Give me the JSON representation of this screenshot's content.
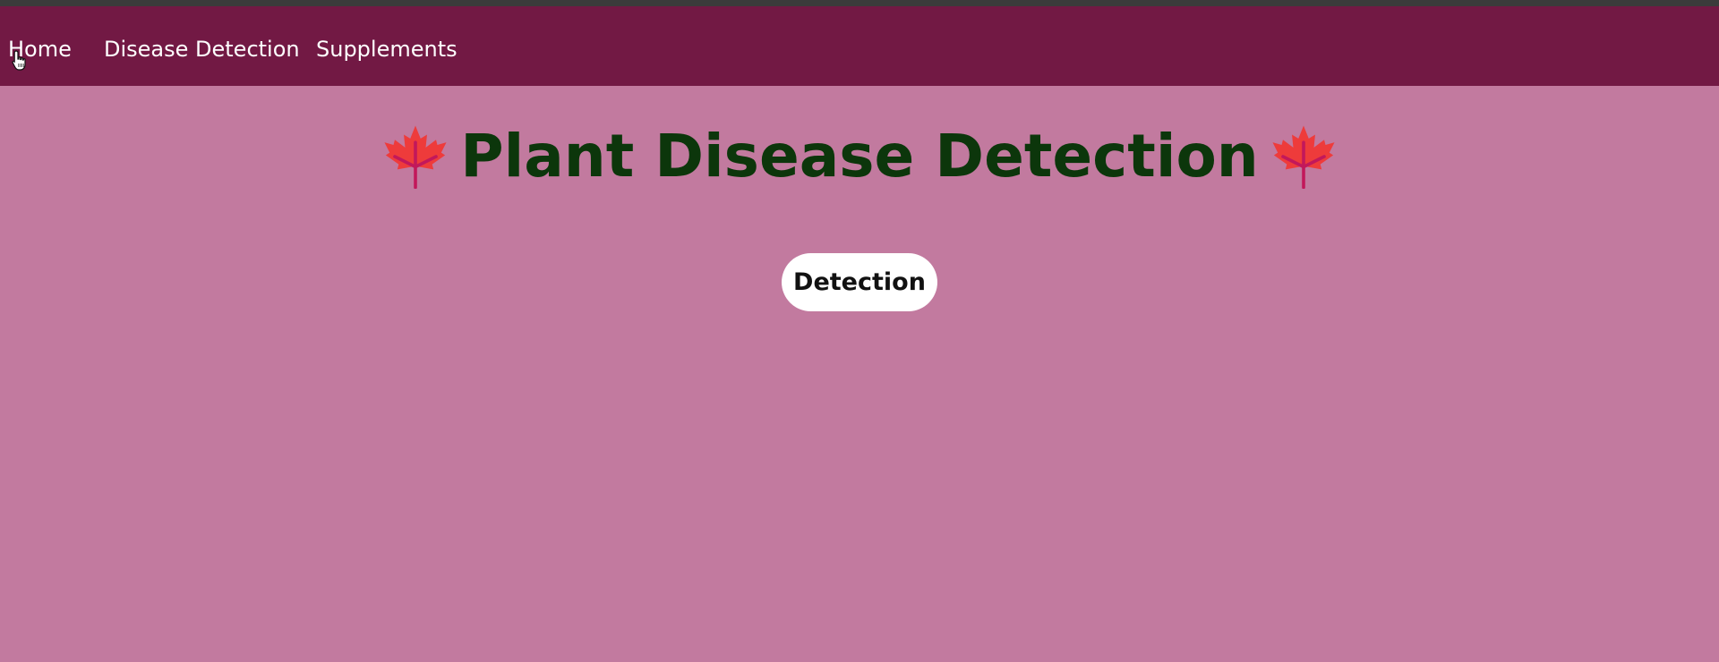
{
  "nav": {
    "items": [
      {
        "label": "Home"
      },
      {
        "label": "Disease Detection"
      },
      {
        "label": "Supplements"
      }
    ]
  },
  "hero": {
    "title": "Plant Disease Detection",
    "leaf_icon": "maple-leaf-icon"
  },
  "actions": {
    "detect_label": "Detection"
  },
  "colors": {
    "background": "#c27a9f",
    "navbar": "#721944",
    "title": "#0c360b",
    "leaf": "#ee3b3b",
    "leaf_vein": "#c2185b"
  }
}
